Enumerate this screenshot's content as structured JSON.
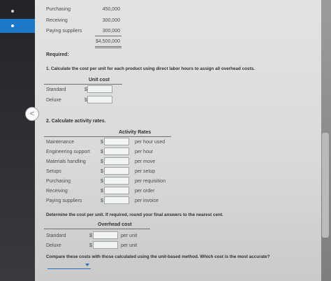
{
  "top_table": {
    "rows": [
      {
        "label": "Purchasing",
        "value": "450,000"
      },
      {
        "label": "Receiving",
        "value": "300,000"
      },
      {
        "label": "Paying suppliers",
        "value": "300,000"
      }
    ],
    "total": "$4,500,000"
  },
  "required_heading": "Required:",
  "q1": {
    "text": "1. Calculate the cost per unit for each product using direct labor hours to assign all overhead costs.",
    "column_header": "Unit cost",
    "rows": [
      {
        "label": "Standard",
        "currency": "$",
        "value": ""
      },
      {
        "label": "Deluxe",
        "currency": "$",
        "value": ""
      }
    ]
  },
  "q2": {
    "text": "2. Calculate activity rates.",
    "column_header": "Activity Rates",
    "rows": [
      {
        "label": "Maintenance",
        "currency": "$",
        "value": "",
        "unit": "per hour used"
      },
      {
        "label": "Engineering support",
        "currency": "$",
        "value": "",
        "unit": "per hour"
      },
      {
        "label": "Materials handling",
        "currency": "$",
        "value": "",
        "unit": "per move"
      },
      {
        "label": "Setups",
        "currency": "$",
        "value": "",
        "unit": "per setup"
      },
      {
        "label": "Purchasing",
        "currency": "$",
        "value": "",
        "unit": "per requisition"
      },
      {
        "label": "Receiving",
        "currency": "$",
        "value": "",
        "unit": "per order"
      },
      {
        "label": "Paying suppliers",
        "currency": "$",
        "value": "",
        "unit": "per invoice"
      }
    ]
  },
  "q3": {
    "text": "Determine the cost per unit. If required, round your final answers to the nearest cent.",
    "column_header": "Overhead cost",
    "rows": [
      {
        "label": "Standard",
        "currency": "$",
        "value": "",
        "unit": "per unit"
      },
      {
        "label": "Deluxe",
        "currency": "$",
        "value": "",
        "unit": "per unit"
      }
    ]
  },
  "q4": {
    "text": "Compare these costs with those calculated using the unit-based method. Which cost is the most accurate?",
    "select_value": ""
  },
  "nav": {
    "back_glyph": "<"
  },
  "colors": {
    "accent": "#1c79c9",
    "paper": "#dcdddc",
    "sidebar": "#26272b"
  }
}
